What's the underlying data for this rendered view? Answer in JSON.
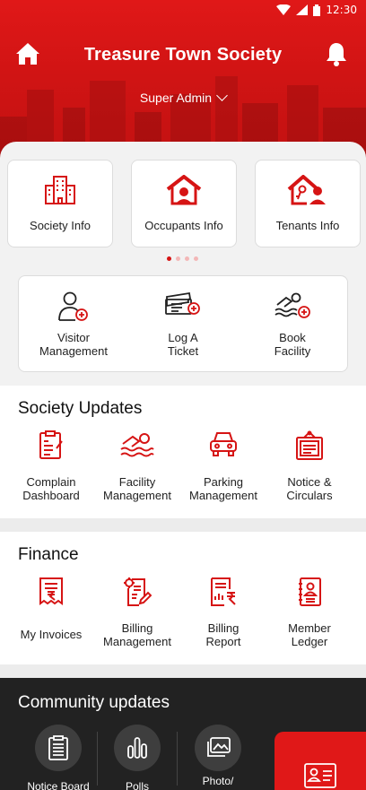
{
  "status_bar": {
    "time": "12:30"
  },
  "header": {
    "title": "Treasure Town Society",
    "role": "Super Admin"
  },
  "info_cards": [
    {
      "label": "Society Info",
      "icon": "building-icon"
    },
    {
      "label": "Occupants Info",
      "icon": "house-person-icon"
    },
    {
      "label": "Tenants Info",
      "icon": "house-key-person-icon"
    }
  ],
  "carousel": {
    "pages": 4,
    "active": 1
  },
  "quick_actions": [
    {
      "line1": "Visitor",
      "line2": "Management",
      "icon": "visitor-add-icon"
    },
    {
      "line1": "Log A",
      "line2": "Ticket",
      "icon": "ticket-add-icon"
    },
    {
      "line1": "Book",
      "line2": "Facility",
      "icon": "swimmer-add-icon"
    }
  ],
  "society_updates": {
    "title": "Society Updates",
    "items": [
      {
        "line1": "Complain",
        "line2": "Dashboard",
        "icon": "complaint-clipboard-icon"
      },
      {
        "line1": "Facility",
        "line2": "Management",
        "icon": "swimmer-icon"
      },
      {
        "line1": "Parking",
        "line2": "Management",
        "icon": "car-icon"
      },
      {
        "line1": "Notice &",
        "line2": "Circulars",
        "icon": "notice-board-icon"
      }
    ]
  },
  "finance": {
    "title": "Finance",
    "items": [
      {
        "line1": "My Invoices",
        "line2": "",
        "icon": "invoice-icon"
      },
      {
        "line1": "Billing",
        "line2": "Management",
        "icon": "billing-gear-icon"
      },
      {
        "line1": "Billing",
        "line2": "Report",
        "icon": "billing-report-icon"
      },
      {
        "line1": "Member",
        "line2": "Ledger",
        "icon": "member-ledger-icon"
      }
    ]
  },
  "community": {
    "title": "Community updates",
    "items": [
      {
        "line1": "Notice Board",
        "line2": "",
        "icon": "clipboard-list-icon"
      },
      {
        "line1": "Polls",
        "line2": "",
        "icon": "bar-chart-icon"
      },
      {
        "line1": "Photo/",
        "line2": "",
        "icon": "photo-gallery-icon"
      }
    ]
  },
  "colors": {
    "brand_red": "#d61414",
    "dark_bg": "#222222"
  }
}
